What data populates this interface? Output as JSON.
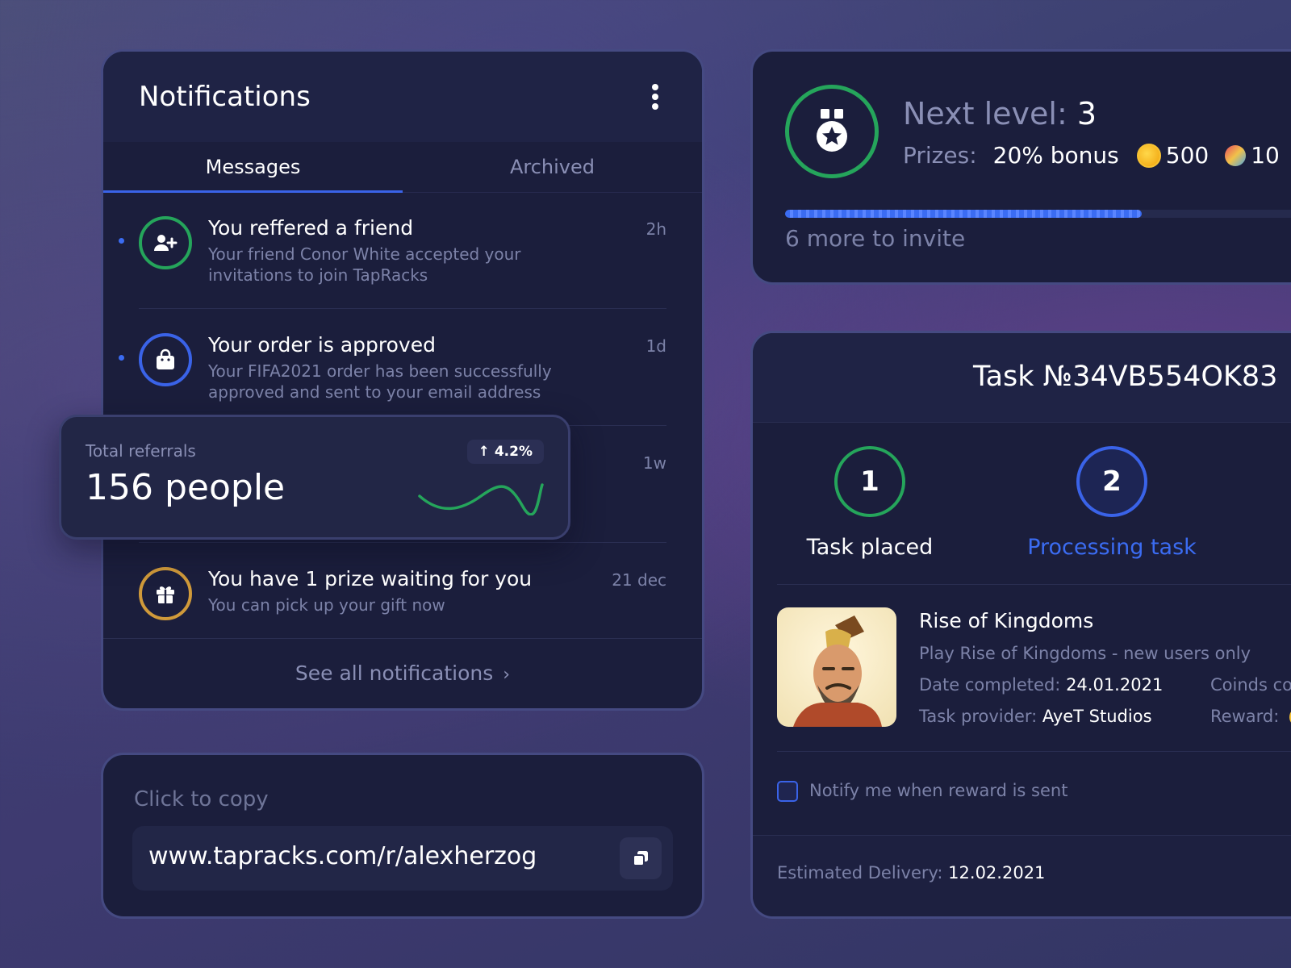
{
  "notifications": {
    "title": "Notifications",
    "tabs": [
      {
        "label": "Messages",
        "active": true
      },
      {
        "label": "Archived",
        "active": false
      }
    ],
    "items": [
      {
        "title": "You reffered a friend",
        "subtitle": "Your friend Conor White accepted your invitations to join TapRacks",
        "time": "2h",
        "icon": "add-user-icon",
        "unread": true
      },
      {
        "title": "Your order is approved",
        "subtitle": "Your FIFA2021 order has been successfully approved and sent to your email address",
        "time": "1d",
        "icon": "shopping-bag-icon",
        "unread": true
      },
      {
        "title": "",
        "subtitle": "",
        "time": "1w",
        "icon": "",
        "unread": false
      },
      {
        "title": "You have 1 prize waiting for you",
        "subtitle": "You can pick up your gift now",
        "time": "21 dec",
        "icon": "gift-icon",
        "unread": false
      }
    ],
    "see_all": "See all notifications"
  },
  "referrals": {
    "label": "Total referrals",
    "value": "156 people",
    "change": "4.2%"
  },
  "copy": {
    "label": "Click to copy",
    "url": "www.tapracks.com/r/alexherzog"
  },
  "level": {
    "next_label": "Next level:",
    "next_value": "3",
    "prizes_label": "Prizes:",
    "bonus": "20% bonus",
    "coins": "500",
    "tickets": "10",
    "progress": 0.65,
    "remaining": "6 more to invite"
  },
  "task": {
    "title": "Task №34VB554OK83",
    "steps": [
      {
        "number": "1",
        "label": "Task placed",
        "state": "done"
      },
      {
        "number": "2",
        "label": "Processing task",
        "state": "current"
      }
    ],
    "game_name": "Rise of Kingdoms",
    "game_desc": "Play Rise of Kingdoms - new users only",
    "date_label": "Date completed:",
    "date_value": "24.01.2021",
    "provider_label": "Task provider:",
    "provider_value": "AyeT Studios",
    "coins_label": "Coinds coc",
    "reward_label": "Reward:",
    "notify_label": "Notify me when reward is sent",
    "delivery_label": "Estimated Delivery:",
    "delivery_value": "12.02.2021"
  },
  "colors": {
    "background": "#3b3f72",
    "card": "#1b1e3c",
    "accent_blue": "#3a63e8",
    "success_green": "#25a55b",
    "gift_orange": "#d09a3a"
  }
}
